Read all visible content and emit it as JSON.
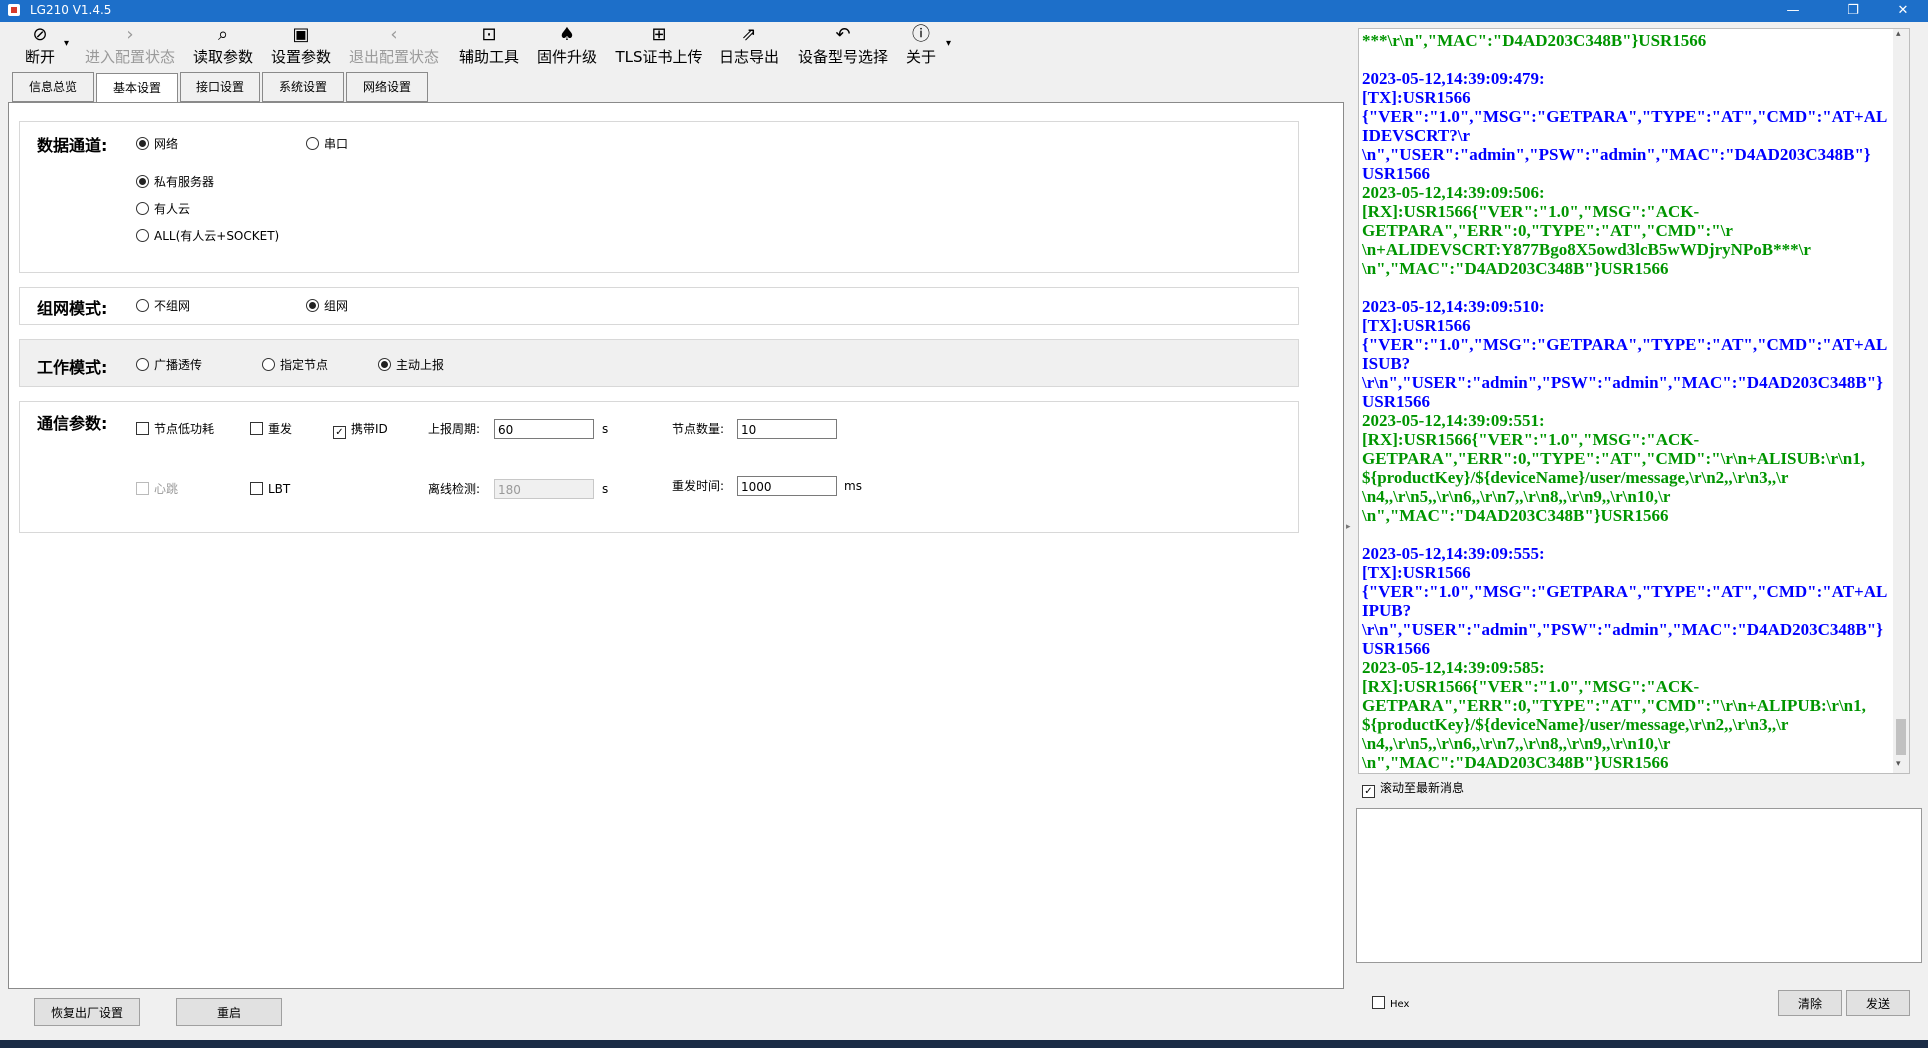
{
  "window": {
    "title": "LG210 V1.4.5",
    "minimize": "—",
    "restore": "❐",
    "close": "✕"
  },
  "toolbar": {
    "items": [
      {
        "icon": "⊘",
        "label": "断开",
        "enabled": true
      },
      {
        "icon": "›",
        "label": "进入配置状态",
        "enabled": false
      },
      {
        "icon": "⌕",
        "label": "读取参数",
        "enabled": true
      },
      {
        "icon": "▣",
        "label": "设置参数",
        "enabled": true
      },
      {
        "icon": "‹",
        "label": "退出配置状态",
        "enabled": false
      },
      {
        "icon": "⊡",
        "label": "辅助工具",
        "enabled": true
      },
      {
        "icon": "♠",
        "label": "固件升级",
        "enabled": true
      },
      {
        "icon": "⊞",
        "label": "TLS证书上传",
        "enabled": true
      },
      {
        "icon": "⇗",
        "label": "日志导出",
        "enabled": true
      },
      {
        "icon": "↶",
        "label": "设备型号选择",
        "enabled": true
      },
      {
        "icon": "ⓘ",
        "label": "关于",
        "enabled": true
      }
    ],
    "dropdown_glyph": "▾"
  },
  "tabs": [
    "信息总览",
    "基本设置",
    "接口设置",
    "系统设置",
    "网络设置"
  ],
  "active_tab": "基本设置",
  "basic": {
    "data_channel": {
      "label": "数据通道:",
      "network": "网络",
      "serial": "串口",
      "private_server": "私有服务器",
      "usr_cloud": "有人云",
      "all": "ALL(有人云+SOCKET)"
    },
    "network_mode": {
      "label": "组网模式:",
      "none": "不组网",
      "mesh": "组网"
    },
    "work_mode": {
      "label": "工作模式:",
      "broadcast": "广播透传",
      "specified": "指定节点",
      "active_report": "主动上报"
    },
    "comm": {
      "label": "通信参数:",
      "low_power": "节点低功耗",
      "resend": "重发",
      "carry_id": "携带ID",
      "report_period_label": "上报周期:",
      "report_period_value": "60",
      "report_period_unit": "s",
      "node_count_label": "节点数量:",
      "node_count_value": "10",
      "heartbeat": "心跳",
      "lbt": "LBT",
      "offline_label": "离线检测:",
      "offline_value": "180",
      "offline_unit": "s",
      "resend_time_label": "重发时间:",
      "resend_time_value": "1000",
      "resend_time_unit": "ms"
    }
  },
  "bottom": {
    "factory_reset": "恢复出厂设置",
    "restart": "重启"
  },
  "log": {
    "entries": [
      {
        "kind": "rx",
        "text": "***\\r\\n\",\"MAC\":\"D4AD203C348B\"}USR1566"
      },
      {
        "kind": "blank",
        "text": " "
      },
      {
        "kind": "tx",
        "text": "2023-05-12,14:39:09:479:\n[TX]:USR1566\n{\"VER\":\"1.0\",\"MSG\":\"GETPARA\",\"TYPE\":\"AT\",\"CMD\":\"AT+ALIDEVSCRT?\\r\n\\n\",\"USER\":\"admin\",\"PSW\":\"admin\",\"MAC\":\"D4AD203C348B\"}\nUSR1566"
      },
      {
        "kind": "rx",
        "text": "2023-05-12,14:39:09:506:\n[RX]:USR1566{\"VER\":\"1.0\",\"MSG\":\"ACK-\nGETPARA\",\"ERR\":0,\"TYPE\":\"AT\",\"CMD\":\"\\r\n\\n+ALIDEVSCRT:Y877Bgo8X5owd3lcB5wWDjryNPoB***\\r\n\\n\",\"MAC\":\"D4AD203C348B\"}USR1566"
      },
      {
        "kind": "blank",
        "text": " "
      },
      {
        "kind": "tx",
        "text": "2023-05-12,14:39:09:510:\n[TX]:USR1566\n{\"VER\":\"1.0\",\"MSG\":\"GETPARA\",\"TYPE\":\"AT\",\"CMD\":\"AT+ALISUB?\n\\r\\n\",\"USER\":\"admin\",\"PSW\":\"admin\",\"MAC\":\"D4AD203C348B\"}\nUSR1566"
      },
      {
        "kind": "rx",
        "text": "2023-05-12,14:39:09:551:\n[RX]:USR1566{\"VER\":\"1.0\",\"MSG\":\"ACK-\nGETPARA\",\"ERR\":0,\"TYPE\":\"AT\",\"CMD\":\"\\r\\n+ALISUB:\\r\\n1,\n${productKey}/${deviceName}/user/message,\\r\\n2,,\\r\\n3,,\\r\n\\n4,,\\r\\n5,,\\r\\n6,,\\r\\n7,,\\r\\n8,,\\r\\n9,,\\r\\n10,\\r\n\\n\",\"MAC\":\"D4AD203C348B\"}USR1566"
      },
      {
        "kind": "blank",
        "text": " "
      },
      {
        "kind": "tx",
        "text": "2023-05-12,14:39:09:555:\n[TX]:USR1566\n{\"VER\":\"1.0\",\"MSG\":\"GETPARA\",\"TYPE\":\"AT\",\"CMD\":\"AT+ALIPUB?\n\\r\\n\",\"USER\":\"admin\",\"PSW\":\"admin\",\"MAC\":\"D4AD203C348B\"}\nUSR1566"
      },
      {
        "kind": "rx",
        "text": "2023-05-12,14:39:09:585:\n[RX]:USR1566{\"VER\":\"1.0\",\"MSG\":\"ACK-\nGETPARA\",\"ERR\":0,\"TYPE\":\"AT\",\"CMD\":\"\\r\\n+ALIPUB:\\r\\n1,\n${productKey}/${deviceName}/user/message,\\r\\n2,,\\r\\n3,,\\r\n\\n4,,\\r\\n5,,\\r\\n6,,\\r\\n7,,\\r\\n8,,\\r\\n9,,\\r\\n10,\\r\n\\n\",\"MAC\":\"D4AD203C348B\"}USR1566"
      }
    ],
    "scroll_to_latest": "滚动至最新消息",
    "hex": "Hex",
    "clear": "清除",
    "send": "发送",
    "tx_color": "#0000ff",
    "rx_color": "#009500"
  }
}
